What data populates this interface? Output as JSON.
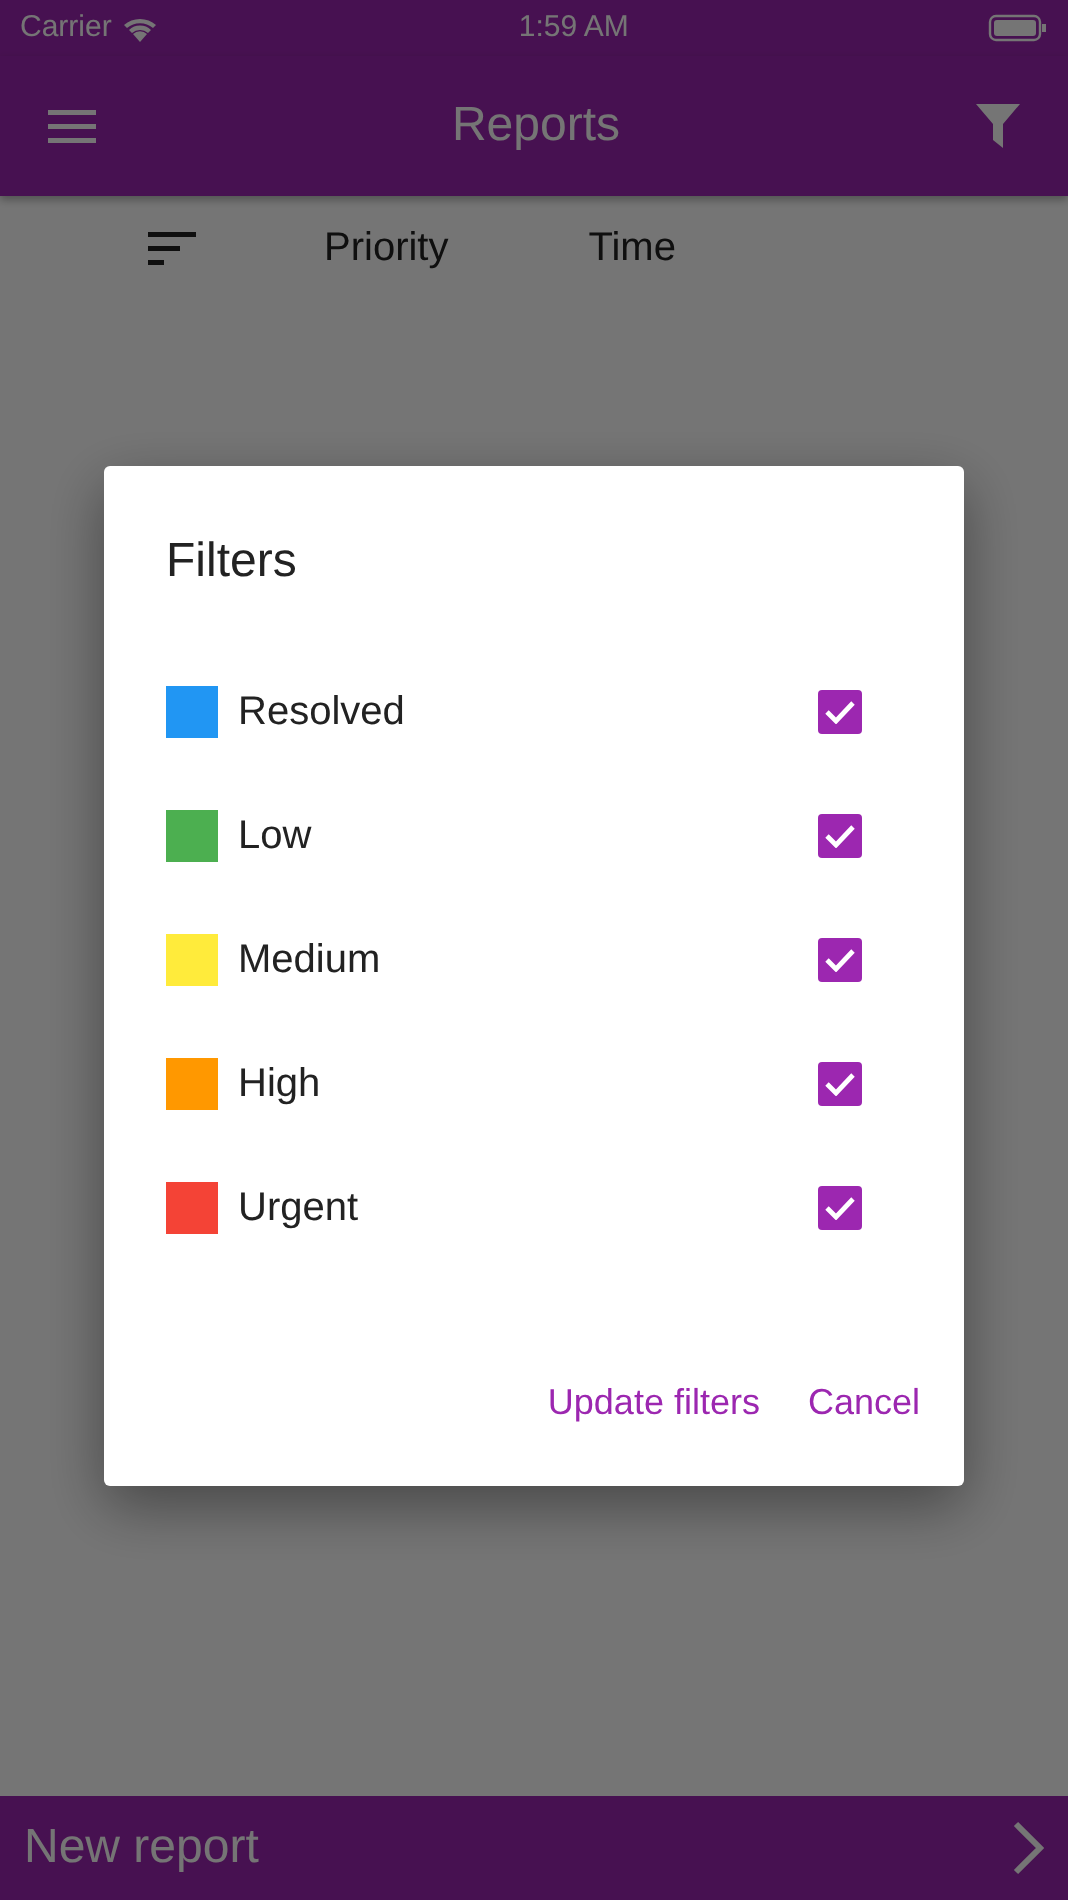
{
  "status_bar": {
    "carrier": "Carrier",
    "time": "1:59 AM"
  },
  "app_bar": {
    "title": "Reports"
  },
  "sort_bar": {
    "columns": [
      "Priority",
      "Time"
    ]
  },
  "dialog": {
    "title": "Filters",
    "filters": [
      {
        "label": "Resolved",
        "color": "#2196f3",
        "checked": true
      },
      {
        "label": "Low",
        "color": "#4caf50",
        "checked": true
      },
      {
        "label": "Medium",
        "color": "#ffeb3b",
        "checked": true
      },
      {
        "label": "High",
        "color": "#ff9800",
        "checked": true
      },
      {
        "label": "Urgent",
        "color": "#f44336",
        "checked": true
      }
    ],
    "buttons": [
      "Update filters",
      "Cancel"
    ]
  },
  "bottom_bar": {
    "label": "New report"
  }
}
